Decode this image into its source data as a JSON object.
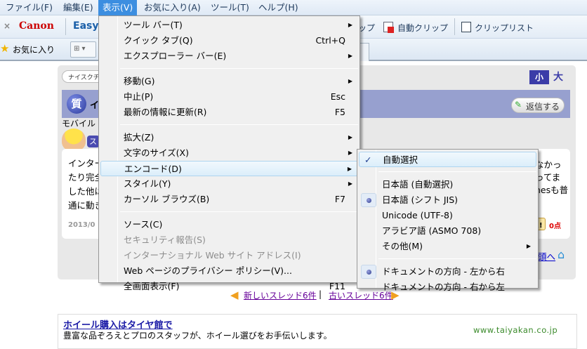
{
  "menubar": [
    "ファイル(F)",
    "編集(E)",
    "表示(V)",
    "お気に入り(A)",
    "ツール(T)",
    "ヘルプ(H)"
  ],
  "toolbar": {
    "close": "×",
    "canon": "Canon",
    "easy": "Easy",
    "clip_partial": "ップ",
    "auto_clip": "自動クリップ",
    "clip_list": "クリップリスト"
  },
  "favbar": {
    "favorites": "お気に入り"
  },
  "page": {
    "pill": "ナイスクチ",
    "size_small": "小",
    "size_large": "大",
    "q_badge": "質",
    "title_partial": "イ",
    "mobile": "モバイル",
    "badge_partial": "ス",
    "body_lines": [
      "インター",
      "たり完全",
      "した他は",
      "通に動き"
    ],
    "date": "2013/0",
    "right_lines": [
      "なかっ",
      "ってま",
      "nesも普"
    ],
    "points": "0点",
    "nice_partial": "ス!",
    "reply": "返信する",
    "to_top": "頭へ",
    "newer": "新しいスレッド6件",
    "sep": "|",
    "older": "古いスレッド6件"
  },
  "ad": {
    "title": "ホイール購入はタイヤ館で",
    "desc": "豊富な品ぞろえとプロのスタッフが、ホイール選びをお手伝いします。",
    "url": "www.taiyakan.co.jp"
  },
  "view_menu": [
    {
      "label": "ツール バー(T)",
      "arrow": true
    },
    {
      "label": "クイック タブ(Q)",
      "key": "Ctrl+Q"
    },
    {
      "label": "エクスプローラー バー(E)",
      "arrow": true
    },
    {
      "sep": true
    },
    {
      "label": "移動(G)",
      "arrow": true
    },
    {
      "label": "中止(P)",
      "key": "Esc"
    },
    {
      "label": "最新の情報に更新(R)",
      "key": "F5"
    },
    {
      "sep": true
    },
    {
      "label": "拡大(Z)",
      "arrow": true
    },
    {
      "label": "文字のサイズ(X)",
      "arrow": true
    },
    {
      "label": "エンコード(D)",
      "arrow": true,
      "highlight": true
    },
    {
      "label": "スタイル(Y)",
      "arrow": true
    },
    {
      "label": "カーソル ブラウズ(B)",
      "key": "F7"
    },
    {
      "sep": true
    },
    {
      "label": "ソース(C)"
    },
    {
      "label": "セキュリティ報告(S)",
      "disabled": true
    },
    {
      "label": "インターナショナル Web サイト アドレス(I)",
      "disabled": true
    },
    {
      "label": "Web ページのプライバシー ポリシー(V)..."
    },
    {
      "label": "全画面表示(F)",
      "key": "F11"
    }
  ],
  "encode_menu": [
    {
      "label": "自動選択",
      "check": true,
      "highlight": true
    },
    {
      "sep": true
    },
    {
      "label": "日本語 (自動選択)"
    },
    {
      "label": "日本語 (シフト JIS)",
      "bullet": true
    },
    {
      "label": "Unicode (UTF-8)"
    },
    {
      "label": "アラビア語 (ASMO 708)"
    },
    {
      "label": "その他(M)",
      "arrow": true
    },
    {
      "sep": true
    },
    {
      "label": "ドキュメントの方向 - 左から右",
      "bullet": true
    },
    {
      "label": "ドキュメントの方向 - 右から左"
    }
  ]
}
